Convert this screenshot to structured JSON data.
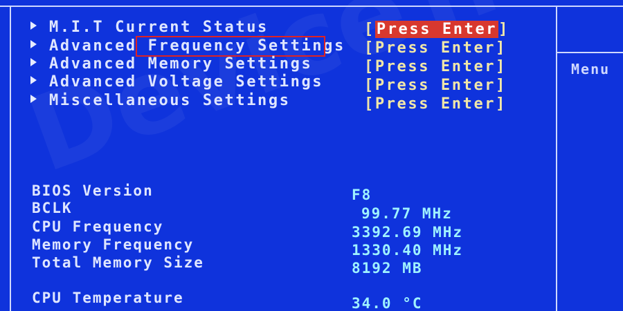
{
  "menu": {
    "items": [
      {
        "label": "M.I.T Current Status",
        "action": "Press Enter"
      },
      {
        "label": "Advanced",
        "label_rest": "Frequency Settings",
        "action": "Press Enter"
      },
      {
        "label": "Advanced Memory Settings",
        "action": "Press Enter"
      },
      {
        "label": "Advanced Voltage Settings",
        "action": "Press Enter"
      },
      {
        "label": "Miscellaneous Settings",
        "action": "Press Enter"
      }
    ]
  },
  "info": {
    "bios_version": {
      "label": "BIOS Version",
      "value": "F8"
    },
    "bclk": {
      "label": "BCLK",
      "value": "99.77 MHz"
    },
    "cpu_frequency": {
      "label": "CPU Frequency",
      "value": "3392.69 MHz"
    },
    "memory_frequency": {
      "label": "Memory Frequency",
      "value": "1330.40 MHz"
    },
    "total_memory": {
      "label": "Total Memory Size",
      "value": "8192 MB"
    },
    "cpu_temperature": {
      "label": "CPU Temperature",
      "value": "34.0 °C"
    }
  },
  "help_panel": {
    "title": "Menu"
  },
  "watermark": "DeviceTricks",
  "colors": {
    "background": "#0f33dc",
    "selection": "#d8382e",
    "highlight_box": "#e02222",
    "action_text": "#f1e7a8",
    "value_text": "#9ff2ff"
  }
}
